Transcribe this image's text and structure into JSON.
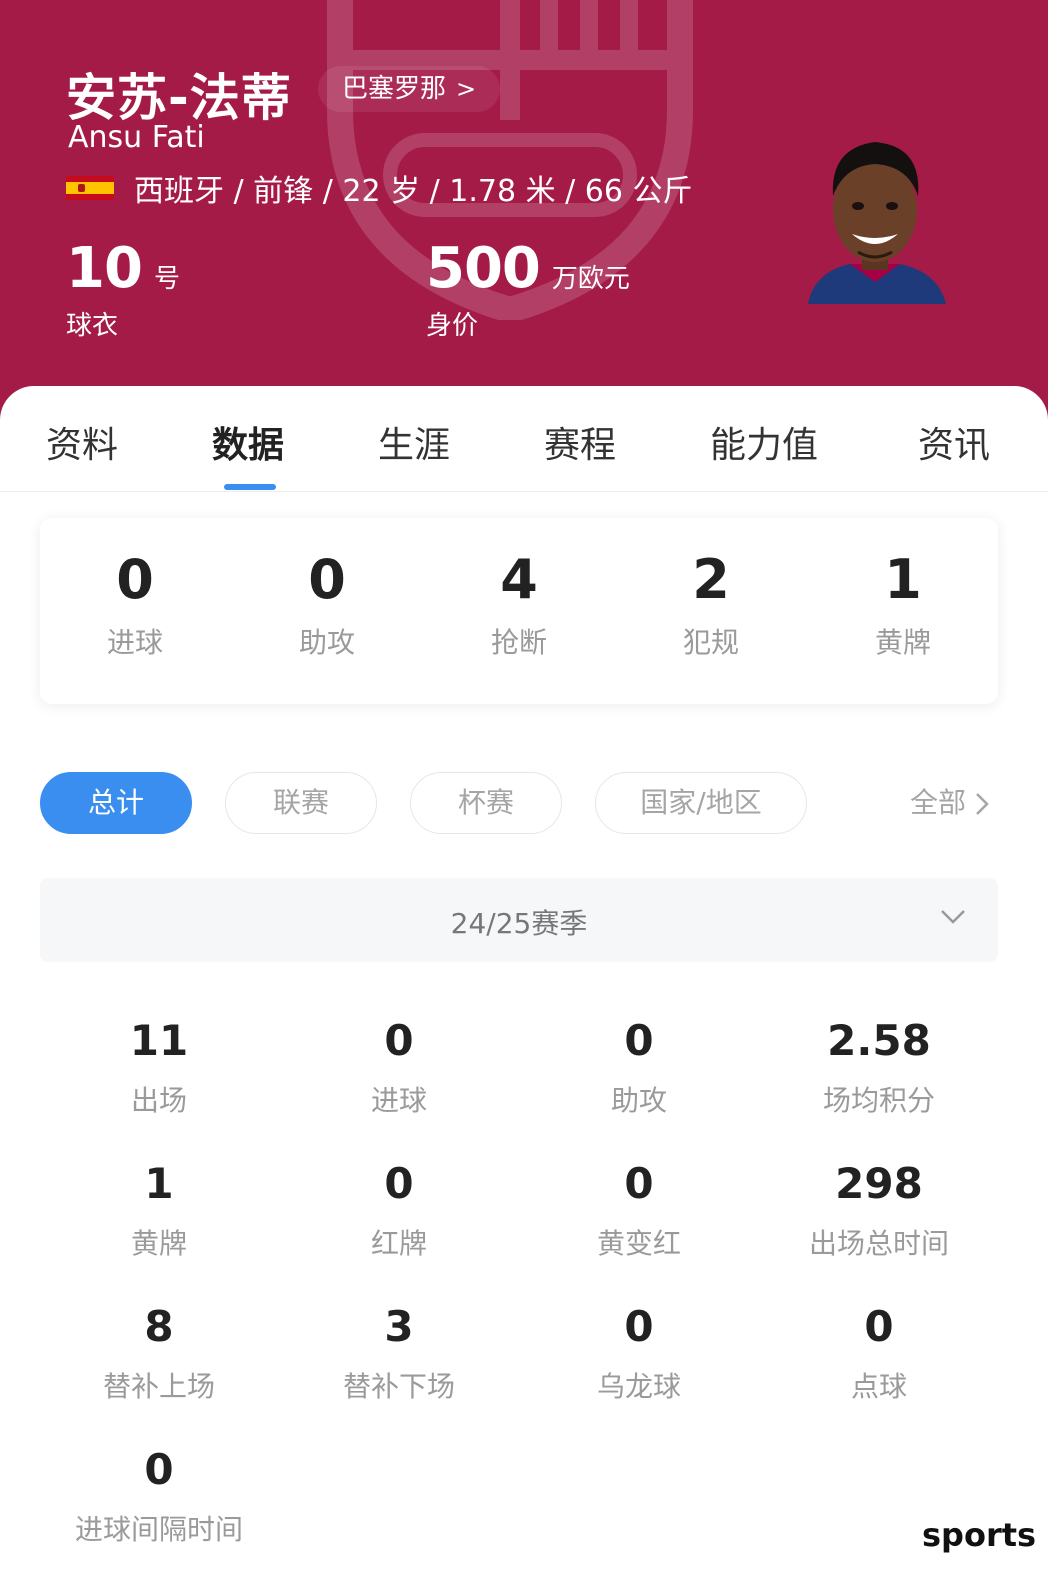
{
  "header": {
    "name": "安苏-法蒂",
    "club_label": "巴塞罗那",
    "club_chevron": ">",
    "name_en": "Ansu Fati",
    "info": "西班牙 / 前锋 / 22 岁 / 1.78 米 / 66 公斤",
    "jersey": {
      "value": "10",
      "unit": "号",
      "label": "球衣"
    },
    "market_value": {
      "value": "500",
      "unit": "万欧元",
      "label": "身价"
    },
    "flag_icon": "spain-flag-icon",
    "bg_color": "#a41b48"
  },
  "tabs": [
    {
      "label": "资料"
    },
    {
      "label": "数据"
    },
    {
      "label": "生涯"
    },
    {
      "label": "赛程"
    },
    {
      "label": "能力值"
    },
    {
      "label": "资讯"
    }
  ],
  "active_tab": "数据",
  "summary": [
    {
      "value": "0",
      "label": "进球"
    },
    {
      "value": "0",
      "label": "助攻"
    },
    {
      "value": "4",
      "label": "抢断"
    },
    {
      "value": "2",
      "label": "犯规"
    },
    {
      "value": "1",
      "label": "黄牌"
    }
  ],
  "filters": {
    "chips": [
      {
        "label": "总计"
      },
      {
        "label": "联赛"
      },
      {
        "label": "杯赛"
      },
      {
        "label": "国家/地区"
      }
    ],
    "all_label": "全部",
    "accent": "#3a8ef0"
  },
  "season": {
    "label": "24/25赛季"
  },
  "stats": [
    {
      "value": "11",
      "label": "出场"
    },
    {
      "value": "0",
      "label": "进球"
    },
    {
      "value": "0",
      "label": "助攻"
    },
    {
      "value": "2.58",
      "label": "场均积分"
    },
    {
      "value": "1",
      "label": "黄牌"
    },
    {
      "value": "0",
      "label": "红牌"
    },
    {
      "value": "0",
      "label": "黄变红"
    },
    {
      "value": "298",
      "label": "出场总时间"
    },
    {
      "value": "8",
      "label": "替补上场"
    },
    {
      "value": "3",
      "label": "替补下场"
    },
    {
      "value": "0",
      "label": "乌龙球"
    },
    {
      "value": "0",
      "label": "点球"
    },
    {
      "value": "0",
      "label": "进球间隔时间"
    }
  ],
  "watermark": "sports"
}
